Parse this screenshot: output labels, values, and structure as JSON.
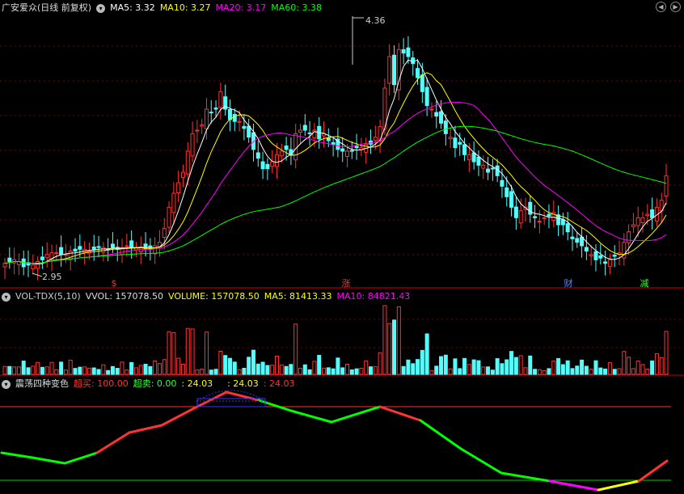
{
  "header": {
    "title": "广安爱众(日线 前复权)",
    "ma5": "MA5: 3.32",
    "ma10": "MA10: 3.27",
    "ma20": "MA20: 3.17",
    "ma60": "MA60: 3.38"
  },
  "annotations": {
    "high": "4.36",
    "low": "2.95"
  },
  "markers": [
    "$",
    "涨",
    "财",
    "减"
  ],
  "volume_panel": {
    "name": "VOL-TDX(5,10)",
    "vvol": "VVOL: 157078.50",
    "volume": "VOLUME: 157078.50",
    "ma5": "MA5: 81413.33",
    "ma10": "MA10: 84821.43"
  },
  "osc_panel": {
    "name": "震荡四种变色",
    "overbuy": "超买: 100.00",
    "oversell": "超卖: 0.00",
    "v1": ": 24.03",
    "v2": ": 24.03",
    "v3": ": 24.03"
  },
  "colors": {
    "up": "#ff3232",
    "down": "#54fcfc",
    "ma5": "#ffffff",
    "ma10": "#ffff00",
    "ma20": "#ff00ff",
    "ma60": "#00ff00",
    "grid": "#7a0000"
  },
  "chart_data": {
    "type": "candlestick",
    "price_series": [
      {
        "name": "MA5",
        "value": "3.32"
      },
      {
        "name": "MA10",
        "value": "3.27"
      },
      {
        "name": "MA20",
        "value": "3.17"
      },
      {
        "name": "MA60",
        "value": "3.38"
      }
    ],
    "price_high": 4.36,
    "price_low": 2.95,
    "ohlc_close_approx": [
      2.98,
      2.99,
      3.0,
      2.99,
      2.96,
      2.97,
      2.97,
      2.99,
      3.0,
      3.03,
      3.04,
      3.04,
      3.03,
      3.03,
      3.05,
      3.05,
      3.06,
      3.06,
      3.05,
      3.06,
      3.07,
      3.07,
      3.06,
      3.07,
      3.06,
      3.07,
      3.08,
      3.07,
      3.07,
      3.07,
      3.06,
      3.06,
      3.08,
      3.1,
      3.18,
      3.3,
      3.38,
      3.44,
      3.5,
      3.62,
      3.72,
      3.74,
      3.77,
      3.86,
      3.84,
      3.86,
      3.96,
      3.86,
      3.8,
      3.79,
      3.79,
      3.75,
      3.7,
      3.63,
      3.58,
      3.52,
      3.52,
      3.56,
      3.6,
      3.62,
      3.63,
      3.6,
      3.72,
      3.74,
      3.74,
      3.72,
      3.74,
      3.69,
      3.72,
      3.68,
      3.66,
      3.63,
      3.62,
      3.62,
      3.62,
      3.64,
      3.64,
      3.66,
      3.66,
      3.7,
      3.76,
      3.98,
      4.16,
      4.0,
      4.2,
      4.18,
      4.16,
      4.12,
      4.04,
      3.96,
      3.88,
      3.86,
      3.82,
      3.78,
      3.72,
      3.7,
      3.64,
      3.66,
      3.6,
      3.6,
      3.56,
      3.54,
      3.54,
      3.5,
      3.52,
      3.48,
      3.42,
      3.36,
      3.3,
      3.24,
      3.28,
      3.3,
      3.26,
      3.24,
      3.22,
      3.24,
      3.25,
      3.27,
      3.2,
      3.2,
      3.16,
      3.12,
      3.1,
      3.08,
      3.05,
      3.03,
      3.0,
      3.01,
      2.98,
      3.0,
      3.02,
      3.04,
      3.1,
      3.16,
      3.2,
      3.24,
      3.24,
      3.26,
      3.24,
      3.3,
      3.34,
      3.48
    ],
    "volume_latest": 157078.5,
    "volume_ma5": 81413.33,
    "volume_ma10": 84821.43,
    "osc_overbuy": 100.0,
    "osc_oversell": 0.0,
    "osc_latest": 24.03
  }
}
